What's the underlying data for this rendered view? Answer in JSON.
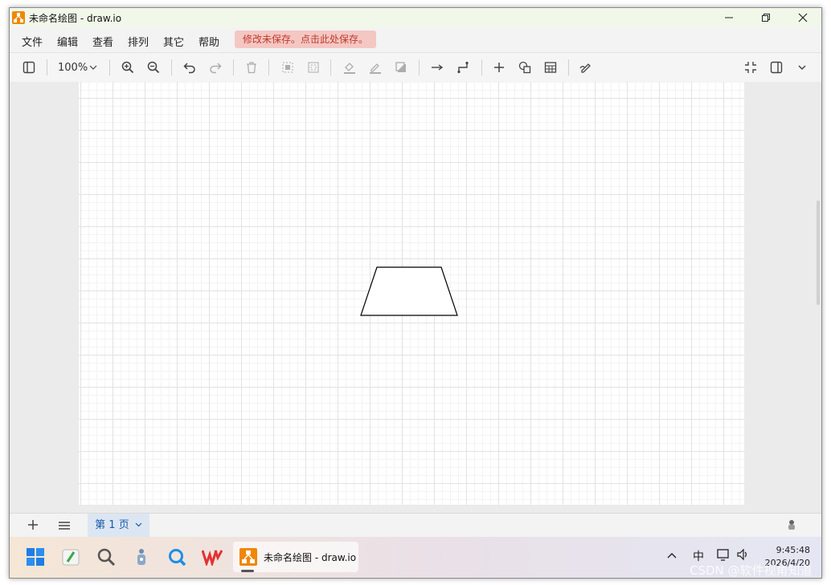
{
  "window": {
    "title": "未命名绘图 - draw.io"
  },
  "menu": {
    "items": [
      "文件",
      "编辑",
      "查看",
      "排列",
      "其它",
      "帮助"
    ],
    "unsaved_notice": "修改未保存。点击此处保存。"
  },
  "toolbar": {
    "zoom": "100%"
  },
  "footer": {
    "page_tab": "第 1 页"
  },
  "taskbar": {
    "app_label": "未命名绘图 - draw.io",
    "ime": "中",
    "time": "9:45:48",
    "date": "2026/4/20"
  },
  "watermark": "CSDN @软件视角知道",
  "colors": {
    "accent": "#f08705",
    "unsaved_bg": "#f4c7c3",
    "page_tab_bg": "#dce6f3"
  }
}
